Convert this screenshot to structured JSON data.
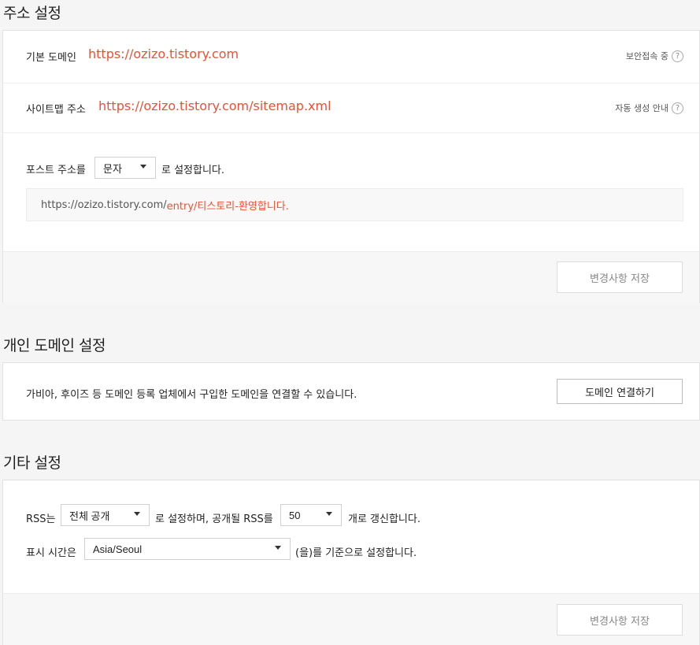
{
  "address_settings": {
    "title": "주소 설정",
    "default_domain_label": "기본 도메인",
    "default_domain_value": "https://ozizo.tistory.com",
    "secure_text": "보안접속 중",
    "sitemap_label": "사이트맵 주소",
    "sitemap_value": "https://ozizo.tistory.com/sitemap.xml",
    "sitemap_help": "자동 생성 안내",
    "help_glyph": "?",
    "post_addr_prefix": "포스트 주소를",
    "post_addr_select": "문자",
    "post_addr_suffix": "로 설정합니다.",
    "preview_base": "https://ozizo.tistory.com/",
    "preview_path": "entry/티스토리-환영합니다.",
    "save_button": "변경사항 저장"
  },
  "custom_domain": {
    "title": "개인 도메인 설정",
    "description": "가비아, 후이즈 등 도메인 등록 업체에서 구입한 도메인을 연결할 수 있습니다.",
    "connect_button": "도메인 연결하기"
  },
  "other_settings": {
    "title": "기타 설정",
    "rss_prefix": "RSS는",
    "rss_visibility_select": "전체 공개",
    "rss_middle": "로 설정하며, 공개될 RSS를",
    "rss_count_select": "50",
    "rss_suffix": "개로 갱신합니다.",
    "time_prefix": "표시 시간은",
    "timezone_select": "Asia/Seoul",
    "time_suffix": "(을)를 기준으로 설정합니다.",
    "save_button": "변경사항 저장"
  },
  "colors": {
    "accent": "#f04e32",
    "background": "#f5f5f5"
  }
}
